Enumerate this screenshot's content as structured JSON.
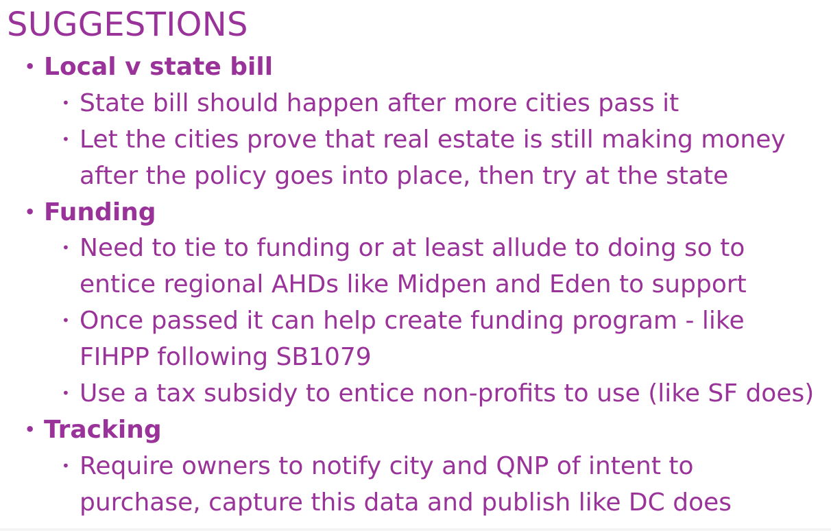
{
  "slide": {
    "title": "SUGGESTIONS",
    "sections": [
      {
        "heading": "Local v state bill",
        "items": [
          {
            "lines": [
              "State bill should happen after more cities pass it"
            ]
          },
          {
            "lines": [
              "Let the cities prove that real estate is still making money",
              "after the policy goes into place, then try at the state"
            ]
          }
        ]
      },
      {
        "heading": "Funding",
        "items": [
          {
            "lines": [
              "Need to tie to funding or at least allude to doing so to",
              "entice regional AHDs like Midpen and Eden to support"
            ]
          },
          {
            "lines": [
              "Once passed it can help create funding program - like",
              "FIHPP following SB1079"
            ]
          },
          {
            "lines": [
              "Use a tax subsidy to entice non-profits to use (like SF does)"
            ]
          }
        ]
      },
      {
        "heading": "Tracking",
        "items": [
          {
            "lines": [
              "Require owners to notify city and QNP of intent to",
              "purchase, capture this data and publish like DC does"
            ]
          }
        ]
      }
    ],
    "bullet_glyph": "•",
    "text_color": "#993399",
    "background_color": "#ffffff"
  }
}
